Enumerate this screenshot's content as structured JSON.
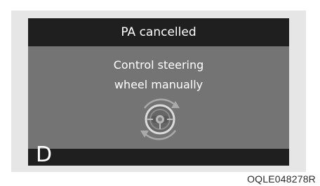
{
  "display": {
    "header_title": "PA cancelled",
    "message_line1": "Control steering",
    "message_line2": "wheel manually",
    "gear_indicator": "D",
    "steering_icon": "steering-wheel-rotate-icon"
  },
  "image_code": "OQLE048278R",
  "colors": {
    "frame": "#e6e6e6",
    "screen": "#747474",
    "bars": "#1f1f1f",
    "text": "#ffffff"
  }
}
